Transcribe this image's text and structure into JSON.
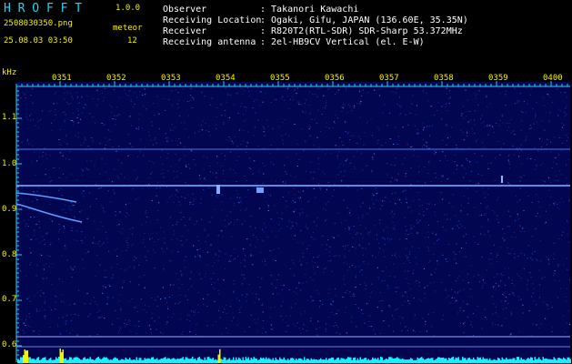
{
  "header": {
    "app_title": "H R O F F T",
    "version": "1.0.0",
    "filename": "2508030350.png",
    "datetime": "25.08.03 03:50",
    "meteor_label": "meteor",
    "meteor_count": "12"
  },
  "info": [
    {
      "label": "Observer",
      "value": ": Takanori Kawachi"
    },
    {
      "label": "Receiving Location",
      "value": ": Ogaki, Gifu, JAPAN (136.60E, 35.35N)"
    },
    {
      "label": "Receiver",
      "value": ": R820T2(RTL-SDR) SDR-Sharp 53.372MHz"
    },
    {
      "label": "Receiving antenna",
      "value": ": 2el-HB9CV Vertical (el. E-W)"
    }
  ],
  "axis": {
    "unit": "kHz",
    "y_ticks": [
      "1.1",
      "1.0",
      "0.9",
      "0.8",
      "0.7",
      "0.6"
    ],
    "x_ticks": [
      "0351",
      "0352",
      "0353",
      "0354",
      "0355",
      "0356",
      "0357",
      "0358",
      "0359",
      "0400"
    ]
  },
  "colors": {
    "background": "#000000",
    "spectrogram": "#020550",
    "text_cyan": "#21d4ef",
    "text_yellow": "#f5f200",
    "trace": "#4a8cff",
    "level_bar": "#19f0ff",
    "level_peak": "#f5f200"
  }
}
